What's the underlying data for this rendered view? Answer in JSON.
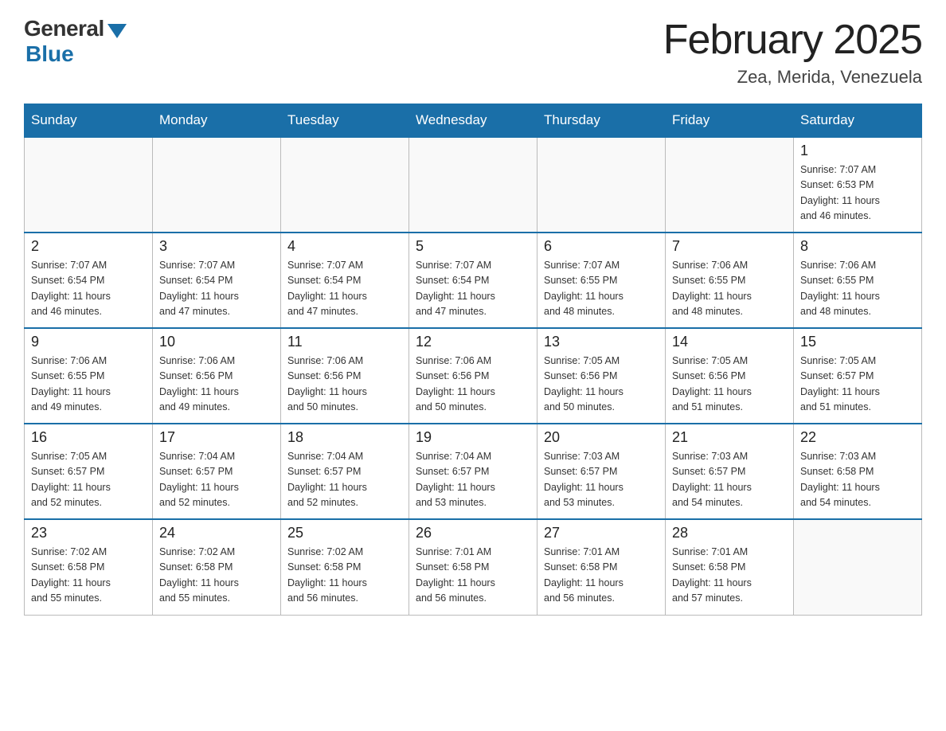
{
  "header": {
    "logo_general": "General",
    "logo_blue": "Blue",
    "month_title": "February 2025",
    "location": "Zea, Merida, Venezuela"
  },
  "weekdays": [
    "Sunday",
    "Monday",
    "Tuesday",
    "Wednesday",
    "Thursday",
    "Friday",
    "Saturday"
  ],
  "weeks": [
    [
      {
        "day": "",
        "info": ""
      },
      {
        "day": "",
        "info": ""
      },
      {
        "day": "",
        "info": ""
      },
      {
        "day": "",
        "info": ""
      },
      {
        "day": "",
        "info": ""
      },
      {
        "day": "",
        "info": ""
      },
      {
        "day": "1",
        "info": "Sunrise: 7:07 AM\nSunset: 6:53 PM\nDaylight: 11 hours\nand 46 minutes."
      }
    ],
    [
      {
        "day": "2",
        "info": "Sunrise: 7:07 AM\nSunset: 6:54 PM\nDaylight: 11 hours\nand 46 minutes."
      },
      {
        "day": "3",
        "info": "Sunrise: 7:07 AM\nSunset: 6:54 PM\nDaylight: 11 hours\nand 47 minutes."
      },
      {
        "day": "4",
        "info": "Sunrise: 7:07 AM\nSunset: 6:54 PM\nDaylight: 11 hours\nand 47 minutes."
      },
      {
        "day": "5",
        "info": "Sunrise: 7:07 AM\nSunset: 6:54 PM\nDaylight: 11 hours\nand 47 minutes."
      },
      {
        "day": "6",
        "info": "Sunrise: 7:07 AM\nSunset: 6:55 PM\nDaylight: 11 hours\nand 48 minutes."
      },
      {
        "day": "7",
        "info": "Sunrise: 7:06 AM\nSunset: 6:55 PM\nDaylight: 11 hours\nand 48 minutes."
      },
      {
        "day": "8",
        "info": "Sunrise: 7:06 AM\nSunset: 6:55 PM\nDaylight: 11 hours\nand 48 minutes."
      }
    ],
    [
      {
        "day": "9",
        "info": "Sunrise: 7:06 AM\nSunset: 6:55 PM\nDaylight: 11 hours\nand 49 minutes."
      },
      {
        "day": "10",
        "info": "Sunrise: 7:06 AM\nSunset: 6:56 PM\nDaylight: 11 hours\nand 49 minutes."
      },
      {
        "day": "11",
        "info": "Sunrise: 7:06 AM\nSunset: 6:56 PM\nDaylight: 11 hours\nand 50 minutes."
      },
      {
        "day": "12",
        "info": "Sunrise: 7:06 AM\nSunset: 6:56 PM\nDaylight: 11 hours\nand 50 minutes."
      },
      {
        "day": "13",
        "info": "Sunrise: 7:05 AM\nSunset: 6:56 PM\nDaylight: 11 hours\nand 50 minutes."
      },
      {
        "day": "14",
        "info": "Sunrise: 7:05 AM\nSunset: 6:56 PM\nDaylight: 11 hours\nand 51 minutes."
      },
      {
        "day": "15",
        "info": "Sunrise: 7:05 AM\nSunset: 6:57 PM\nDaylight: 11 hours\nand 51 minutes."
      }
    ],
    [
      {
        "day": "16",
        "info": "Sunrise: 7:05 AM\nSunset: 6:57 PM\nDaylight: 11 hours\nand 52 minutes."
      },
      {
        "day": "17",
        "info": "Sunrise: 7:04 AM\nSunset: 6:57 PM\nDaylight: 11 hours\nand 52 minutes."
      },
      {
        "day": "18",
        "info": "Sunrise: 7:04 AM\nSunset: 6:57 PM\nDaylight: 11 hours\nand 52 minutes."
      },
      {
        "day": "19",
        "info": "Sunrise: 7:04 AM\nSunset: 6:57 PM\nDaylight: 11 hours\nand 53 minutes."
      },
      {
        "day": "20",
        "info": "Sunrise: 7:03 AM\nSunset: 6:57 PM\nDaylight: 11 hours\nand 53 minutes."
      },
      {
        "day": "21",
        "info": "Sunrise: 7:03 AM\nSunset: 6:57 PM\nDaylight: 11 hours\nand 54 minutes."
      },
      {
        "day": "22",
        "info": "Sunrise: 7:03 AM\nSunset: 6:58 PM\nDaylight: 11 hours\nand 54 minutes."
      }
    ],
    [
      {
        "day": "23",
        "info": "Sunrise: 7:02 AM\nSunset: 6:58 PM\nDaylight: 11 hours\nand 55 minutes."
      },
      {
        "day": "24",
        "info": "Sunrise: 7:02 AM\nSunset: 6:58 PM\nDaylight: 11 hours\nand 55 minutes."
      },
      {
        "day": "25",
        "info": "Sunrise: 7:02 AM\nSunset: 6:58 PM\nDaylight: 11 hours\nand 56 minutes."
      },
      {
        "day": "26",
        "info": "Sunrise: 7:01 AM\nSunset: 6:58 PM\nDaylight: 11 hours\nand 56 minutes."
      },
      {
        "day": "27",
        "info": "Sunrise: 7:01 AM\nSunset: 6:58 PM\nDaylight: 11 hours\nand 56 minutes."
      },
      {
        "day": "28",
        "info": "Sunrise: 7:01 AM\nSunset: 6:58 PM\nDaylight: 11 hours\nand 57 minutes."
      },
      {
        "day": "",
        "info": ""
      }
    ]
  ]
}
